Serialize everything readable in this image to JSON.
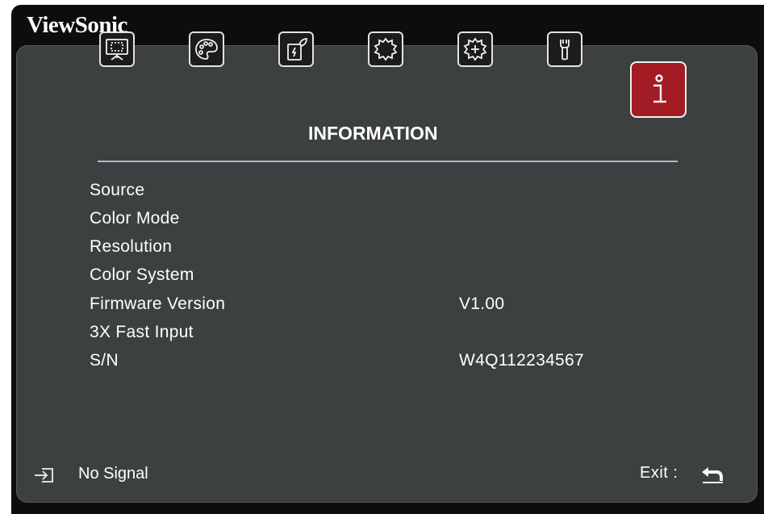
{
  "brand": "ViewSonic",
  "menu": {
    "tabs": [
      {
        "name": "display-icon"
      },
      {
        "name": "palette-icon"
      },
      {
        "name": "power-save-icon"
      },
      {
        "name": "basic-settings-icon"
      },
      {
        "name": "advanced-settings-icon"
      },
      {
        "name": "wrench-icon"
      },
      {
        "name": "information-icon",
        "active": true
      }
    ],
    "active_title": "INFORMATION"
  },
  "info": {
    "rows": [
      {
        "label": "Source",
        "value": ""
      },
      {
        "label": "Color Mode",
        "value": ""
      },
      {
        "label": "Resolution",
        "value": ""
      },
      {
        "label": "Color System",
        "value": ""
      },
      {
        "label": "Firmware Version",
        "value": "V1.00"
      },
      {
        "label": "3X Fast Input",
        "value": ""
      },
      {
        "label": "S/N",
        "value": "W4Q112234567"
      }
    ]
  },
  "footer": {
    "source_icon": "input-source-icon",
    "status": "No Signal",
    "exit_label": "Exit :",
    "exit_icon": "back-arrow-icon"
  },
  "colors": {
    "panel": "#3d4041",
    "frame": "#0d0d0d",
    "active_tab": "#a31c24",
    "divider": "#b5b8c6"
  }
}
